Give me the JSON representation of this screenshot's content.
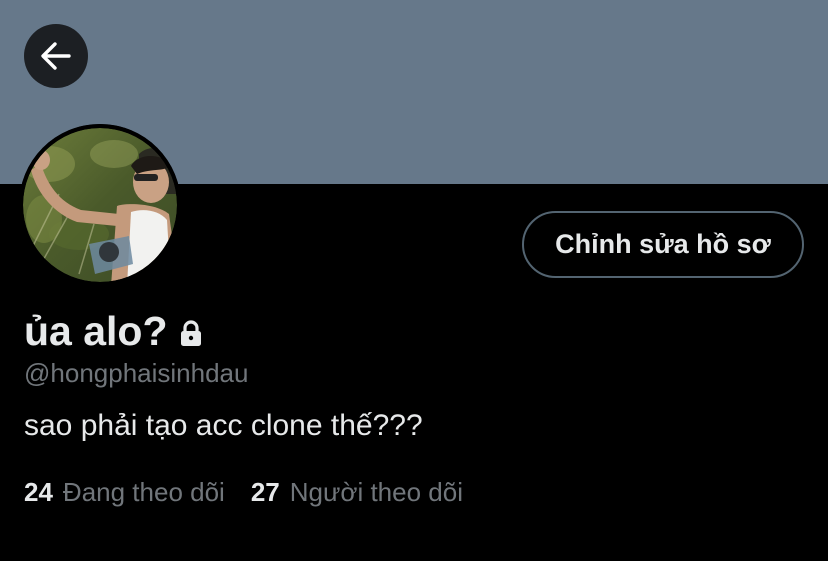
{
  "colors": {
    "banner": "#66788a",
    "background": "#000000",
    "primary_text": "#e7e9ea",
    "secondary_text": "#71767b",
    "button_border": "#536471",
    "back_button_bg": "#1c1f23"
  },
  "header": {
    "back_icon": "arrow-left-icon"
  },
  "profile": {
    "avatar_icon": "profile-photo",
    "edit_label": "Chỉnh sửa hồ sơ",
    "display_name": "ủa alo?",
    "protected_icon": "lock-icon",
    "handle": "@hongphaisinhdau",
    "bio": "sao phải tạo acc clone thế???"
  },
  "stats": {
    "following_count": "24",
    "following_label": "Đang theo dõi",
    "followers_count": "27",
    "followers_label": "Người theo dõi"
  }
}
